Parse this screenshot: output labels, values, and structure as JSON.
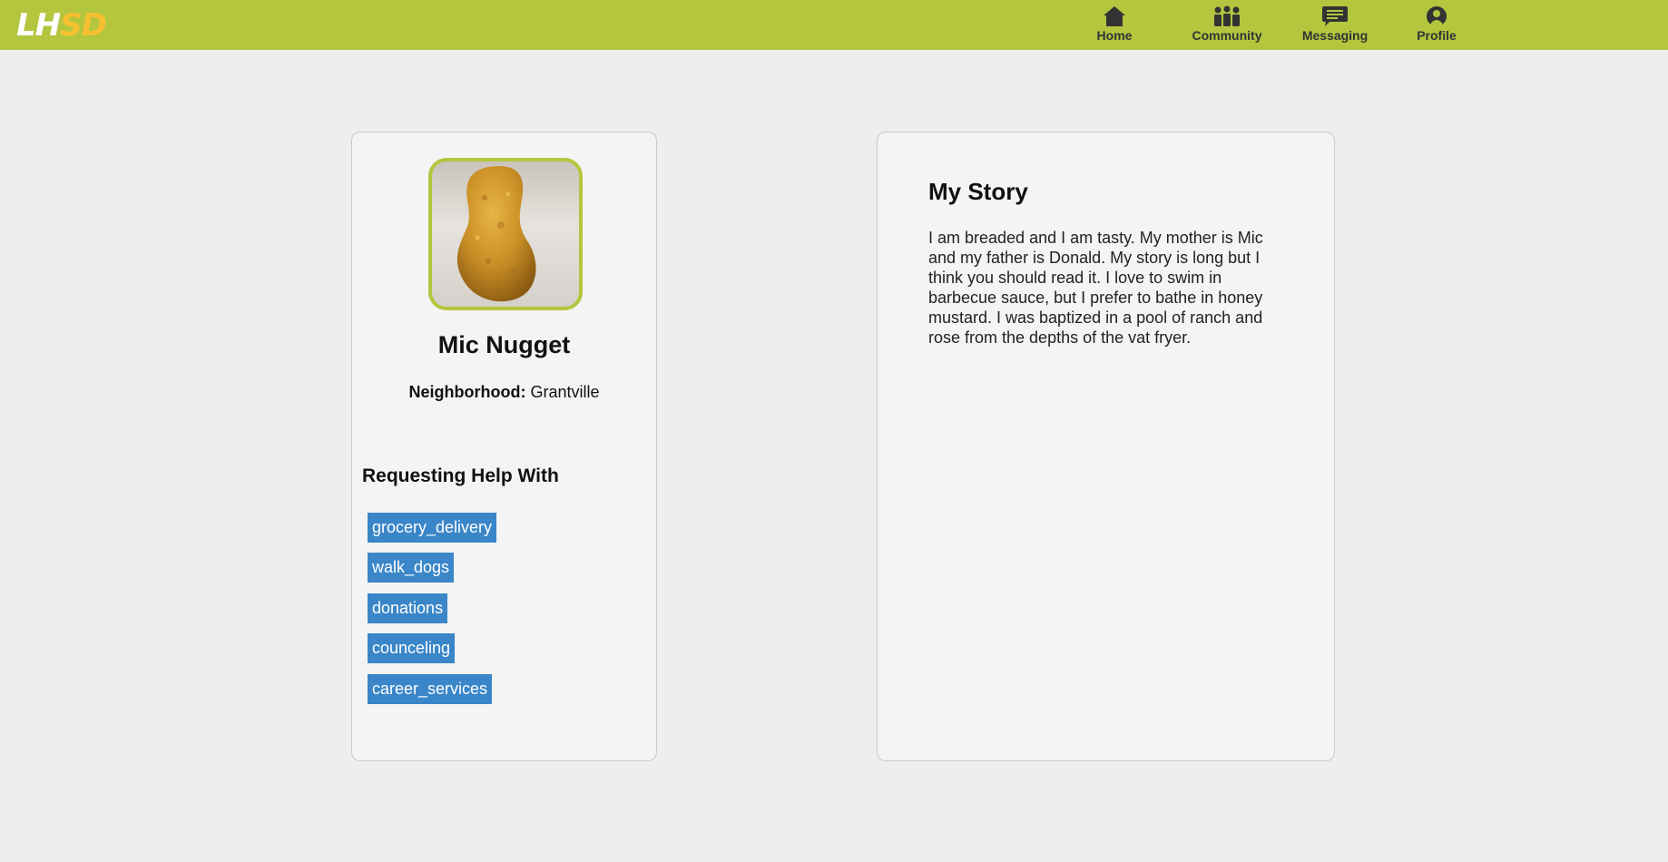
{
  "header": {
    "logo": {
      "part1": "LH",
      "part2": "SD"
    },
    "nav": [
      {
        "label": "Home",
        "icon": "home-icon"
      },
      {
        "label": "Community",
        "icon": "community-icon"
      },
      {
        "label": "Messaging",
        "icon": "messaging-icon"
      },
      {
        "label": "Profile",
        "icon": "profile-icon"
      }
    ],
    "colors": {
      "bar": "#b3c63e",
      "logo_accent": "#f6c031",
      "nav_text": "#333333"
    }
  },
  "profile": {
    "name": "Mic Nugget",
    "neighborhood_label": "Neighborhood:",
    "neighborhood_value": "Grantville",
    "avatar": "chicken-nugget-photo",
    "help_heading": "Requesting Help With",
    "help_tags": [
      "grocery_delivery",
      "walk_dogs",
      "donations",
      "counceling",
      "career_services"
    ],
    "tag_color": "#3a86c8"
  },
  "story": {
    "heading": "My Story",
    "text": "I am breaded and I am tasty. My mother is Mic and my father is Donald. My story is long but I think you should read it. I love to swim in barbecue sauce, but I prefer to bathe in honey mustard. I was baptized in a pool of ranch and rose from the depths of the vat fryer."
  }
}
